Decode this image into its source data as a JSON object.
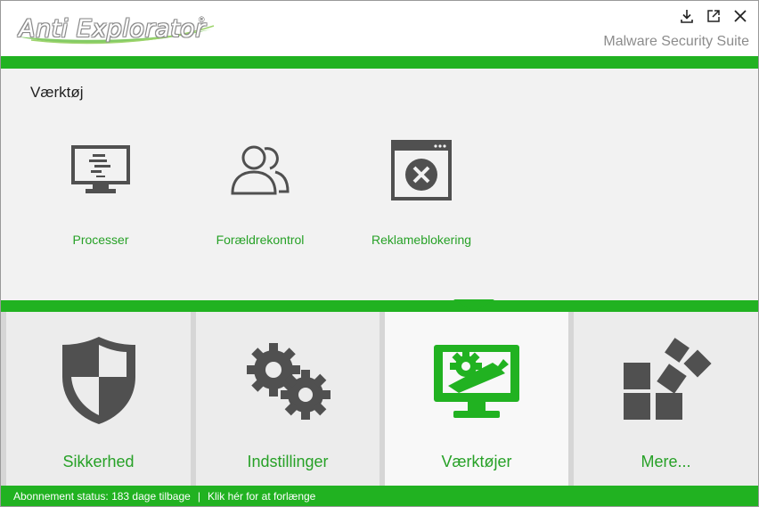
{
  "app": {
    "logo_text": "Anti Explorator",
    "logo_reg": "®",
    "suite": "Malware Security Suite"
  },
  "window_controls": {
    "download_icon": "download-icon",
    "popout_icon": "external-window-icon",
    "close_icon": "close-icon"
  },
  "panel": {
    "title": "Værktøj",
    "tools": [
      {
        "label": "Processer",
        "icon": "monitor-process-icon"
      },
      {
        "label": "Forældrekontrol",
        "icon": "users-icon"
      },
      {
        "label": "Reklameblokering",
        "icon": "window-block-icon"
      }
    ]
  },
  "nav": {
    "tiles": [
      {
        "label": "Sikkerhed",
        "icon": "shield-icon",
        "active": false
      },
      {
        "label": "Indstillinger",
        "icon": "gears-icon",
        "active": false
      },
      {
        "label": "Værktøjer",
        "icon": "tools-monitor-icon",
        "active": true
      },
      {
        "label": "Mere...",
        "icon": "blocks-icon",
        "active": false
      }
    ]
  },
  "status": {
    "subscription": "Abonnement status: 183 dage tilbage",
    "separator": "|",
    "renew_link": "Klik hér for at forlænge"
  },
  "colors": {
    "accent": "#21b221",
    "label_green": "#27a127",
    "icon_gray": "#505050"
  }
}
